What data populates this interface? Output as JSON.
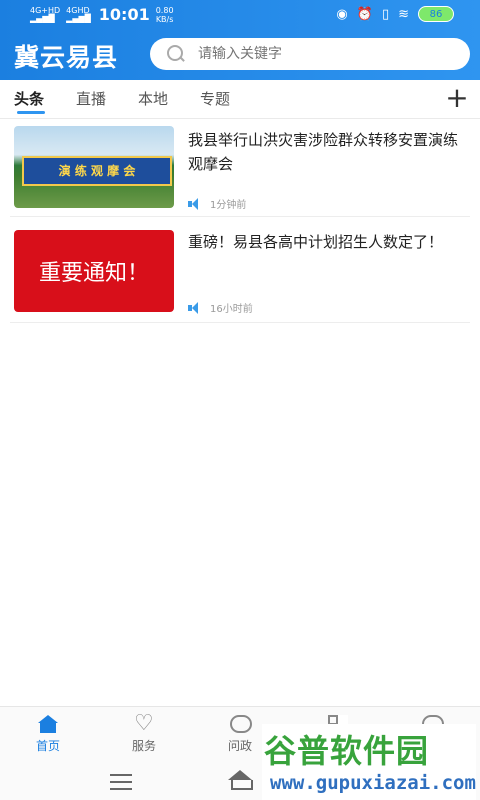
{
  "status_bar": {
    "signal_1": "4G+HD",
    "signal_2": "4GHD",
    "time": "10:01",
    "net_speed": "0.80",
    "net_unit": "KB/s",
    "battery": "86"
  },
  "header": {
    "brand": "冀云易县",
    "search_placeholder": "请输入关键字"
  },
  "tabs": [
    {
      "label": "头条",
      "active": true
    },
    {
      "label": "直播"
    },
    {
      "label": "本地"
    },
    {
      "label": "专题"
    }
  ],
  "articles": [
    {
      "title": "我县举行山洪灾害涉险群众转移安置演练观摩会",
      "thumbnail_text": "演 练 观 摩 会",
      "time": "1分钟前"
    },
    {
      "title": "重磅！易县各高中计划招生人数定了！",
      "thumbnail_text": "重要通知！",
      "time": "16小时前"
    }
  ],
  "bottom_nav": [
    {
      "label": "首页",
      "icon": "home-icon",
      "active": true
    },
    {
      "label": "服务",
      "icon": "heart-icon"
    },
    {
      "label": "问政",
      "icon": "chat-icon"
    },
    {
      "label": "",
      "icon": "grid-icon"
    },
    {
      "label": "",
      "icon": "message-icon"
    }
  ],
  "watermark": {
    "main": "谷普软件园",
    "sub": "www.gupuxiazai.com"
  },
  "colors": {
    "accent": "#1b7fe0",
    "notice_red": "#d80f1a"
  }
}
